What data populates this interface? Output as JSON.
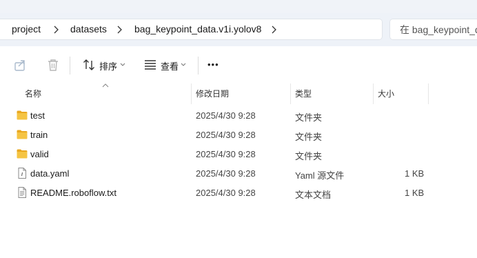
{
  "breadcrumb": {
    "items": [
      "project",
      "datasets",
      "bag_keypoint_data.v1i.yolov8"
    ]
  },
  "search": {
    "placeholder": "在 bag_keypoint_d"
  },
  "toolbar": {
    "share_icon": "share-icon",
    "delete_icon": "trash-icon",
    "sort_label": "排序",
    "view_label": "查看",
    "more_label": "•••"
  },
  "columns": {
    "name": "名称",
    "modified": "修改日期",
    "type": "类型",
    "size": "大小"
  },
  "files": [
    {
      "name": "test",
      "modified": "2025/4/30 9:28",
      "type": "文件夹",
      "size": "",
      "icon": "folder-icon"
    },
    {
      "name": "train",
      "modified": "2025/4/30 9:28",
      "type": "文件夹",
      "size": "",
      "icon": "folder-icon"
    },
    {
      "name": "valid",
      "modified": "2025/4/30 9:28",
      "type": "文件夹",
      "size": "",
      "icon": "folder-icon"
    },
    {
      "name": "data.yaml",
      "modified": "2025/4/30 9:28",
      "type": "Yaml 源文件",
      "size": "1 KB",
      "icon": "yaml-file-icon"
    },
    {
      "name": "README.roboflow.txt",
      "modified": "2025/4/30 9:28",
      "type": "文本文档",
      "size": "1 KB",
      "icon": "text-file-icon"
    }
  ],
  "colors": {
    "folder": "#f5c443",
    "address_bg": "#eef2f8",
    "accent": "#0067c0"
  }
}
